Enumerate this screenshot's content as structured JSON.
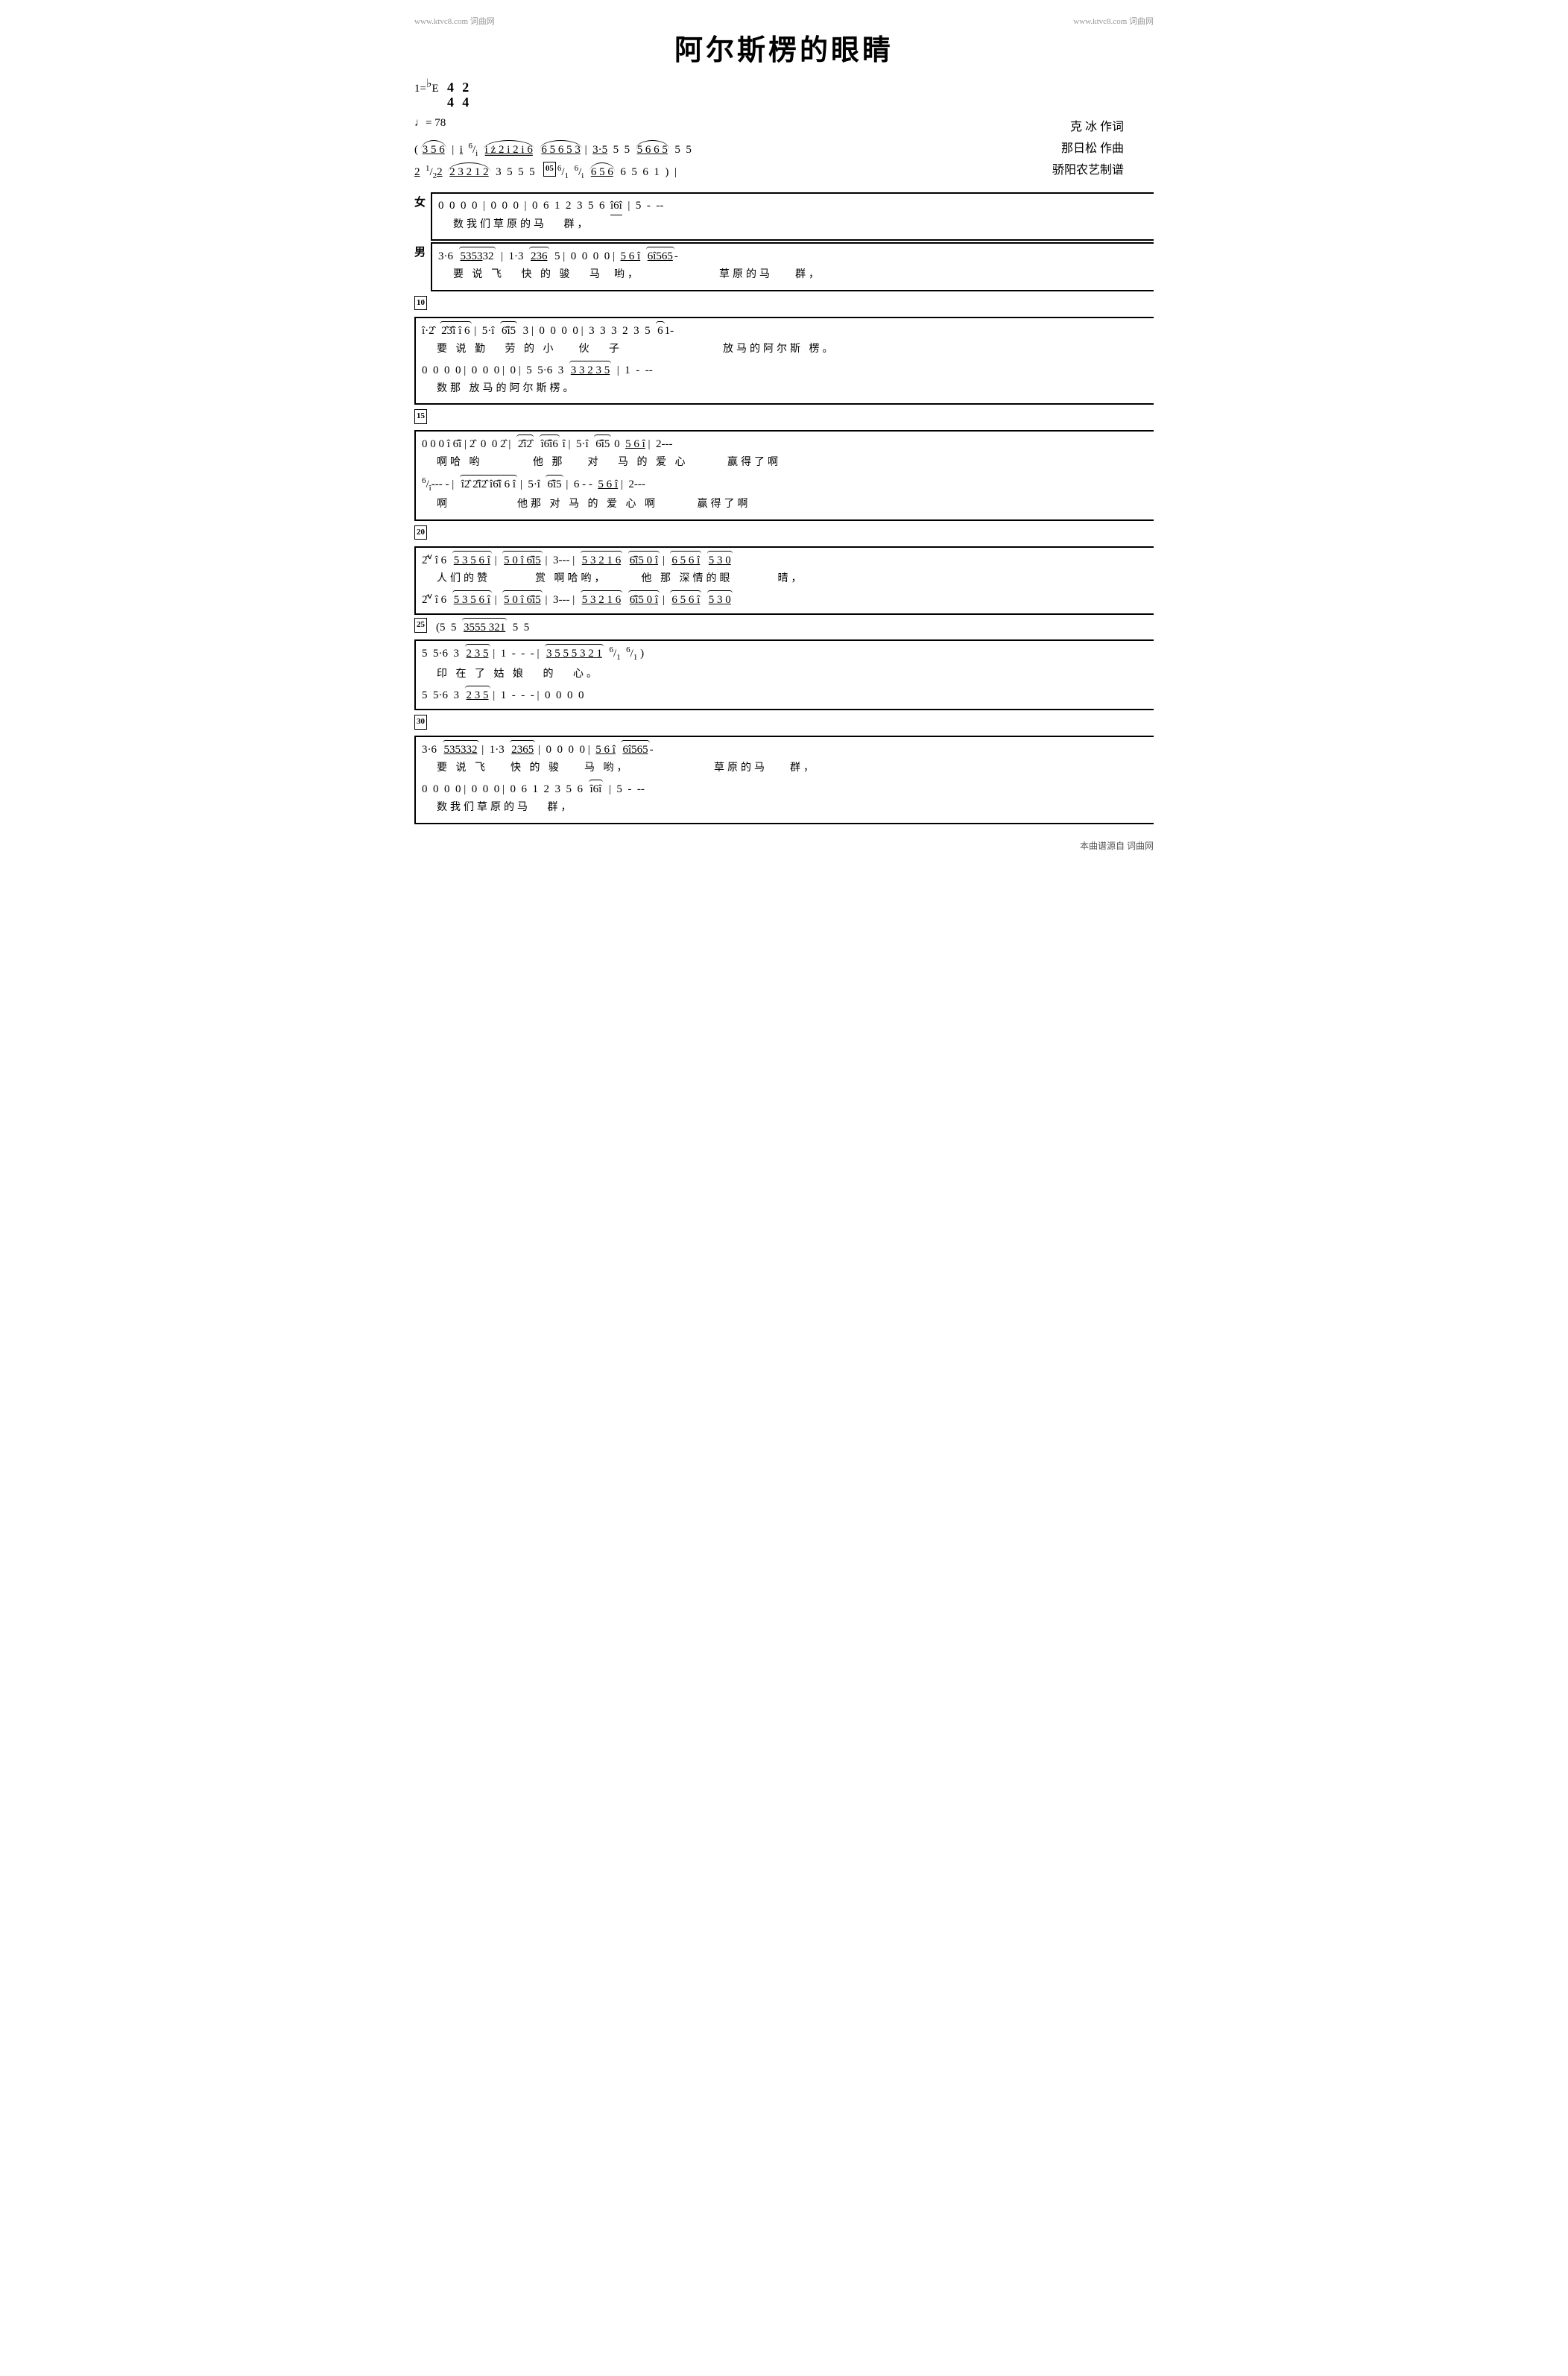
{
  "header": {
    "left_watermark": "www.ktvc8.com 词曲网",
    "right_watermark": "www.ktvc8.com 词曲网"
  },
  "song": {
    "title": "阿尔斯楞的眼睛",
    "lyricist_label": "克 冰 作词",
    "composer_label": "那日松 作曲",
    "arranger_label": "骄阳农艺制谱",
    "key": "1=♭E",
    "time1": "4",
    "time2": "4",
    "time3": "2",
    "time4": "4",
    "tempo": "♩= 78"
  },
  "footer": {
    "text": "本曲谱源自 词曲网"
  },
  "score_lines": [
    "( <u>3  5  6</u>  | <u>i</u>  ⁶∕ᵢ  <u>i̊  2̊  2  i  2  i  6</u>  <u>6  5  6  5  3</u>  | <u>3·5</u>  5  5  <u>5  6  6  5</u>  5  5",
    "<u>2</u>  ½<u>2</u>  <u>2  3  2  1  2</u>  3  5  5  5  [05]⁶∕₁  ⁶∕₁  <u>6  5  6</u>  6  5  6  1  )",
    "",
    "女[  0  0  0  0  | 0  0  0  | 0  6  1  2  3  5  6  î6î | 5  -  --",
    "                                    数我们草原的马   群,",
    "",
    "男[  3·6  5̂3̂5̂3̂2  | 1·3  2̂3̂6̂  5 | 0  0  0  0  | 5  6  î  6̂î5̂6̂5-",
    "   要 说 飞   快 的 骏    马  哟,                   草原的马    群,",
    "",
    "[10]",
    "[ î·2̂  2̂3̂î  î  6 | 5·î  6̂î5  3 | 0  0  0  0  | 3  3  3  2  3  5  6  1-",
    "  要 说 勤   劳 的 小    伙  子                     放马的阿尔斯 楞。",
    "  0  0  0  0  | 0  0  0  | 0 | 5  5·6  3  3  3  2  3  5 | 1  -  --",
    "                                    数那 放马的阿尔斯楞。",
    "",
    "[15]",
    "[ 0  0  0  î  6  î | 2̂  0  0  2̂  | 2̂î2̂  î6̂î  6  î | 5·î  6̂î5  0  <u>5  6  î</u> | 2---",
    "  啊哈 哟              他 那    对    马  的  爱  心         赢得了啊",
    "  ⁶⁄î---  -  | î2̂  2̂î2̂  î6̂î  6  î  | 5·î  6̂î5 | 6  -  -5  6  î | 2---",
    "  啊              他那  对  马  的  爱  心  啊             赢得了啊",
    "",
    "[20]",
    "[ 2̂ⅴ  î  6  <u>5  3  5  6  î</u> | <u>5  0  î  6̂î5</u> | 3---  | <u>5  3  2  1  6</u>  <u>6̂î5  0  î</u> | <u>6  5  6  î</u>  <u>5  3  0</u>",
    "  人们的赞         赏  啊哈哟,          他  那  深情的眼          晴,",
    "  2̂ⅴ  î  6  <u>5  3  5  6  î</u> | <u>5  0  î  6̂î5</u> | 3---  | <u>5  3  2  1  6</u>  <u>6̂î5  0  î</u> | <u>6  5  6  î</u>  <u>5  3  0</u>",
    "",
    "[25]  (5  5  <u>3555  321</u>  5  5",
    "[ 5  5·6  3  <u>2  3  5</u>  | 1  -  -  -  | <u>3  5  5  5  3  2  1</u>  ⁶∕₁  ⁶∕₁  )",
    "  印 在  了 姑  娘   的  心。",
    "  5  5·6  3  <u>2  3  5</u>  | 1  -  -  -  | 0  0  0  0",
    "",
    "[30]",
    "[ 3·6  5̂3̂5̂3̂2  | 1·3  2̂3̂6̂  5 | 0  0  0  0  | 5  6  î  6̂î5̂6̂5-",
    "  要 说 飞   快 的 骏    马  哟,                   草原的马    群,",
    "  0  0  0  0  | 0  0  0  | 0  6  1  2  3  5  6  î6̂î | 5  -  --",
    "                 数我们草原的马   群,"
  ]
}
